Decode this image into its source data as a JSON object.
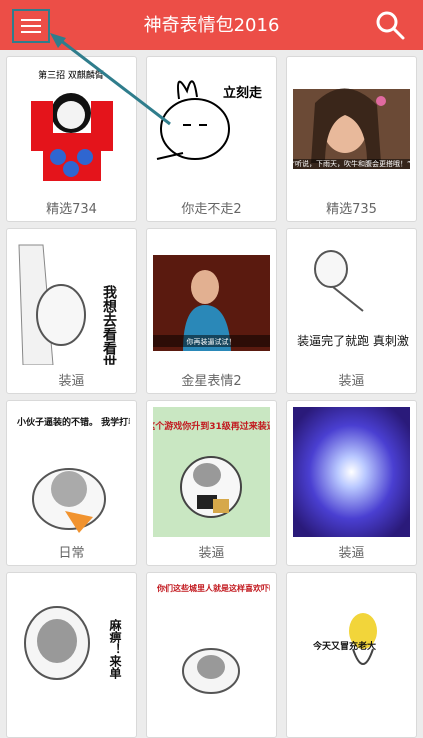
{
  "app": {
    "title": "神奇表情包2016"
  },
  "cards": [
    {
      "caption": "精选734",
      "image_text": "第三招 双麒麟臂"
    },
    {
      "caption": "你走不走2",
      "image_text": "立刻走"
    },
    {
      "caption": "精选735",
      "image_text": "“听说，下雨天，吹牛和腹会更搭哦！”"
    },
    {
      "caption": "装逼",
      "image_text": "我想去看看世界那么大"
    },
    {
      "caption": "金星表情2",
      "image_text": "你再装逼试试！"
    },
    {
      "caption": "装逼",
      "image_text": "装逼完了就跑 真刺激"
    },
    {
      "caption": "日常",
      "image_text": "小伙子逼装的不错。 我学打毛线吧"
    },
    {
      "caption": "装逼",
      "image_text": "等这个游戏你升到31级再过来装逼吧"
    },
    {
      "caption": "装逼",
      "image_text": ""
    },
    {
      "caption": "",
      "image_text": "麻痹！来单"
    },
    {
      "caption": "",
      "image_text": "你们这些城里人就是这样喜欢吓唬我们乡坝头的人！你赶快走吧！我还要给我儿子打毛裤呢"
    },
    {
      "caption": "",
      "image_text": "今天又冒充老大"
    }
  ]
}
